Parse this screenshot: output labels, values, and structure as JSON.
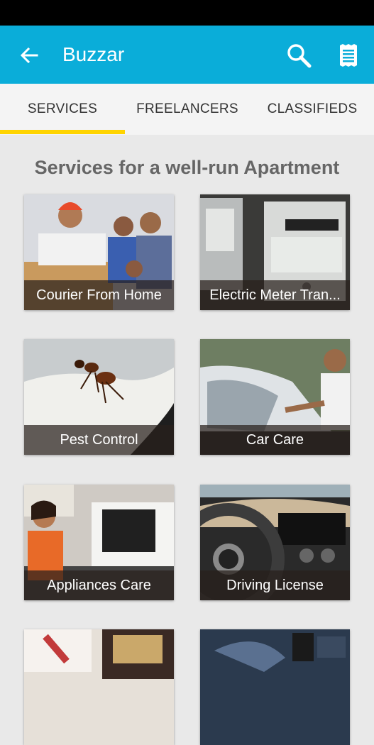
{
  "app_bar": {
    "title": "Buzzar",
    "back_icon": "arrow-left-icon",
    "search_icon": "search-icon",
    "list_icon": "receipt-list-icon",
    "color": "#0aadd9"
  },
  "tabs": [
    {
      "label": "SERVICES",
      "selected": true
    },
    {
      "label": "FREELANCERS",
      "selected": false
    },
    {
      "label": "CLASSIFIEDS",
      "selected": false
    }
  ],
  "tab_indicator_color": "#ffd400",
  "section_title": "Services for a well-run Apartment",
  "services": [
    {
      "label": "Courier From Home"
    },
    {
      "label": "Electric Meter Tran..."
    },
    {
      "label": "Pest Control"
    },
    {
      "label": "Car Care"
    },
    {
      "label": "Appliances Care"
    },
    {
      "label": "Driving License"
    },
    {
      "label": ""
    },
    {
      "label": ""
    }
  ]
}
